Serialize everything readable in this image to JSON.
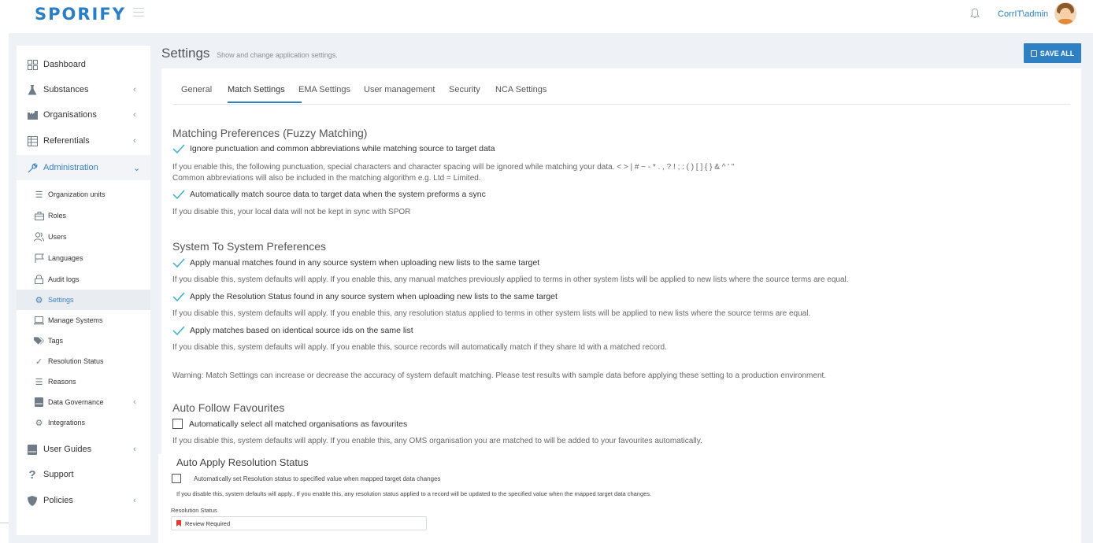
{
  "app": {
    "logo": "SPORIFY",
    "user": "CorrIT\\admin"
  },
  "sidebar": {
    "items": [
      {
        "label": "Dashboard",
        "icon": "dashboard-icon"
      },
      {
        "label": "Substances",
        "icon": "flask-icon"
      },
      {
        "label": "Organisations",
        "icon": "building-icon"
      },
      {
        "label": "Referentials",
        "icon": "table-icon"
      },
      {
        "label": "Administration",
        "icon": "wrench-icon"
      },
      {
        "label": "User Guides",
        "icon": "book-icon"
      },
      {
        "label": "Support",
        "icon": "question-icon"
      },
      {
        "label": "Policies",
        "icon": "shield-icon"
      }
    ],
    "admin_items": [
      {
        "label": "Organization units",
        "icon": "layers-icon"
      },
      {
        "label": "Roles",
        "icon": "briefcase-icon"
      },
      {
        "label": "Users",
        "icon": "users-icon"
      },
      {
        "label": "Languages",
        "icon": "flag-icon"
      },
      {
        "label": "Audit logs",
        "icon": "lock-icon"
      },
      {
        "label": "Settings",
        "icon": "gear-icon"
      },
      {
        "label": "Manage Systems",
        "icon": "laptop-icon"
      },
      {
        "label": "Tags",
        "icon": "tags-icon"
      },
      {
        "label": "Resolution Status",
        "icon": "check-icon"
      },
      {
        "label": "Reasons",
        "icon": "list-icon"
      },
      {
        "label": "Data Governance",
        "icon": "database-icon"
      },
      {
        "label": "Integrations",
        "icon": "cogs-icon"
      }
    ]
  },
  "header": {
    "title": "Settings",
    "subtitle": "Show and change application settings.",
    "save_label": "SAVE ALL"
  },
  "tabs": [
    "General",
    "Match Settings",
    "EMA Settings",
    "User management",
    "Security",
    "NCA Settings"
  ],
  "match_settings": {
    "fuzzy": {
      "title": "Matching Preferences (Fuzzy Matching)",
      "opt1": "Ignore punctuation and common abbreviations while matching source to target data",
      "help1a": "If you enable this, the following punctuation, special characters and character spacing will be ignored while matching your data. < > | # ~ - * . , ? ! ; : ( ) [ ] { } & ^ ' \"",
      "help1b": "Common abbreviations will also be included in the matching algorithm e.g. Ltd = Limited.",
      "opt2": "Automatically match source data to target data when the system preforms a sync",
      "help2": "If you disable this, your local data will not be kept in sync with SPOR"
    },
    "system": {
      "title": "System To System Preferences",
      "opt1": "Apply manual matches found in any source system when uploading new lists to the same target",
      "help1": "If you disable this, system defaults will apply. If you enable this, any manual matches previously applied to terms in other system lists will be applied to new lists where the source terms are equal.",
      "opt2": "Apply the Resolution Status found in any source system when uploading new lists to the same target",
      "help2": "If you disable this, system defaults will apply. If you enable this, any resolution status applied to terms in other system lists will be applied to new lists where the source terms are equal.",
      "opt3": "Apply matches based on identical source ids on the same list",
      "help3": "If you disable this, system defaults will apply. If you enable this, source records will automatically match if they share Id with a matched record.",
      "warning": "Warning: Match Settings can increase or decrease the accuracy of system default matching. Please test results with sample data before applying these setting to a production environment."
    },
    "favourites": {
      "title": "Auto Follow Favourites",
      "opt": "Automatically select all matched organisations as favourites",
      "help": "If you disable this, system defaults will apply. If you enable this, any OMS organisation you are matched to will be added to your favourites automatically."
    },
    "resolution": {
      "title": "Auto Apply Resolution Status",
      "opt": "Automatically set Resolution status to specified value when mapped target data changes",
      "help": "If you disable this, system defaults will apply., If you enable this, any resolution status applied to a record will be updated to the specified value when the mapped target data changes.",
      "field_label": "Resolution Status",
      "field_value": "Review Required"
    }
  },
  "colors": {
    "accent": "#2f7fc3",
    "tick": "#3bb0c9",
    "flag": "#e53935"
  }
}
